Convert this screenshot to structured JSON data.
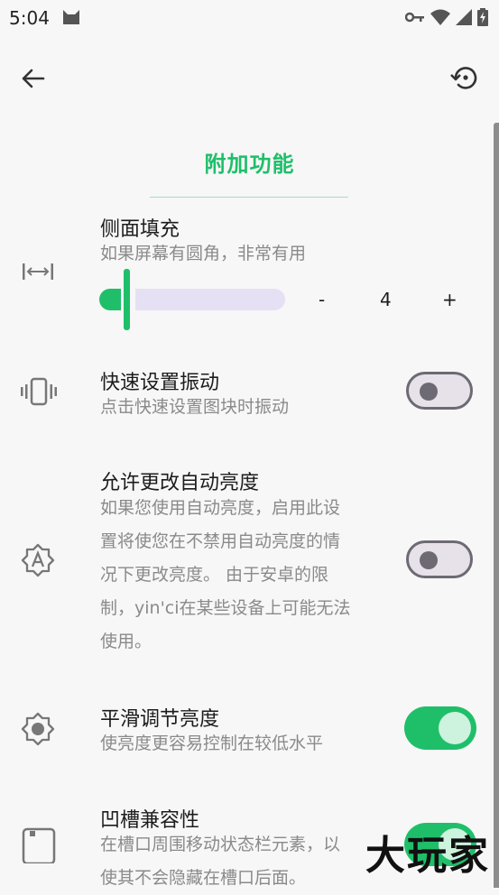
{
  "status_bar": {
    "time": "5:04"
  },
  "header": {
    "title": "附加功能"
  },
  "settings": [
    {
      "title": "侧面填充",
      "subtitle": "如果屏幕有圆角，非常有用"
    },
    {
      "title": "快速设置振动",
      "subtitle": "点击快速设置图块时振动",
      "enabled": false
    },
    {
      "title": "允许更改自动亮度",
      "subtitle_lines": [
        "如果您使用自动亮度，启用此设",
        "置将使您在不禁用自动亮度的情",
        "况下更改亮度。 由于安卓的限",
        "制，yin'ci在某些设备上可能无法",
        "使用。"
      ],
      "enabled": false
    },
    {
      "title": "平滑调节亮度",
      "subtitle": "使亮度更容易控制在较低水平",
      "enabled": true
    },
    {
      "title": "凹槽兼容性",
      "subtitle_lines": [
        "在槽口周围移动状态栏元素，以",
        "使其不会隐藏在槽口后面。"
      ],
      "enabled": true
    }
  ],
  "padding_stepper": {
    "minus": "-",
    "value": "4",
    "plus": "+",
    "slider_fraction": 0.1
  },
  "watermark": "大玩家",
  "colors": {
    "accent": "#1fbf6a",
    "track": "#e6e0f5",
    "toggle_off": "#6e6a73"
  },
  "icons": [
    "back-arrow-icon",
    "restore-icon",
    "side-padding-icon",
    "vibration-icon",
    "auto-brightness-icon",
    "brightness-icon",
    "notch-icon"
  ]
}
